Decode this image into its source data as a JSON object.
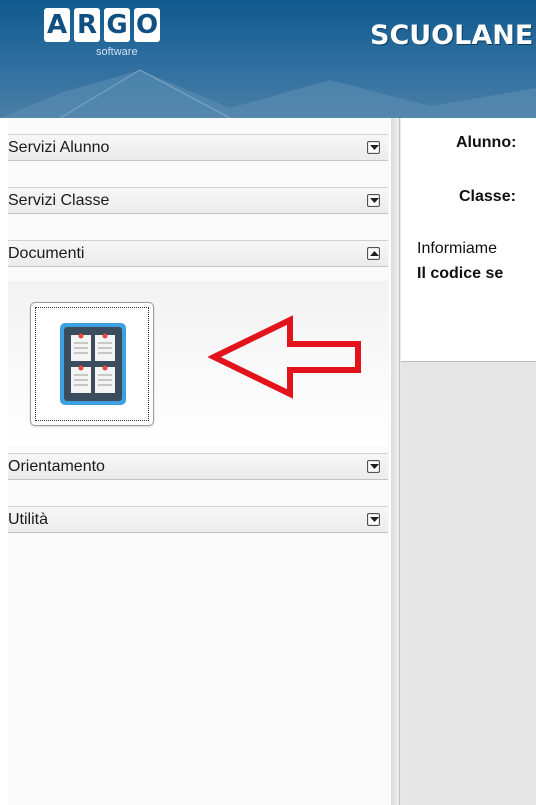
{
  "header": {
    "logo_letters": [
      "A",
      "R",
      "G",
      "O"
    ],
    "logo_subtitle": "software",
    "app_title": "SCUOLANE"
  },
  "sidebar": {
    "sections": [
      {
        "label": "Servizi Alunno",
        "state": "collapsed",
        "icon": "expand-icon"
      },
      {
        "label": "Servizi Classe",
        "state": "collapsed",
        "icon": "expand-icon"
      },
      {
        "label": "Documenti",
        "state": "expanded",
        "icon": "collapse-icon"
      },
      {
        "label": "Orientamento",
        "state": "collapsed",
        "icon": "expand-icon"
      },
      {
        "label": "Utilità",
        "state": "collapsed",
        "icon": "expand-icon"
      }
    ],
    "documenti_button_icon": "bulletin-board-icon"
  },
  "annotation": {
    "arrow_color": "#e3131b",
    "arrow_direction": "left"
  },
  "main": {
    "alunno_label": "Alunno:",
    "classe_label": "Classe:",
    "info_text": "Informiame",
    "code_text": "Il codice se"
  },
  "colors": {
    "header_blue": "#0f5a8f",
    "sidebar_header": "#ebebeb",
    "icon_tile": "#3b4c5c",
    "icon_highlight": "#3da0e0"
  }
}
